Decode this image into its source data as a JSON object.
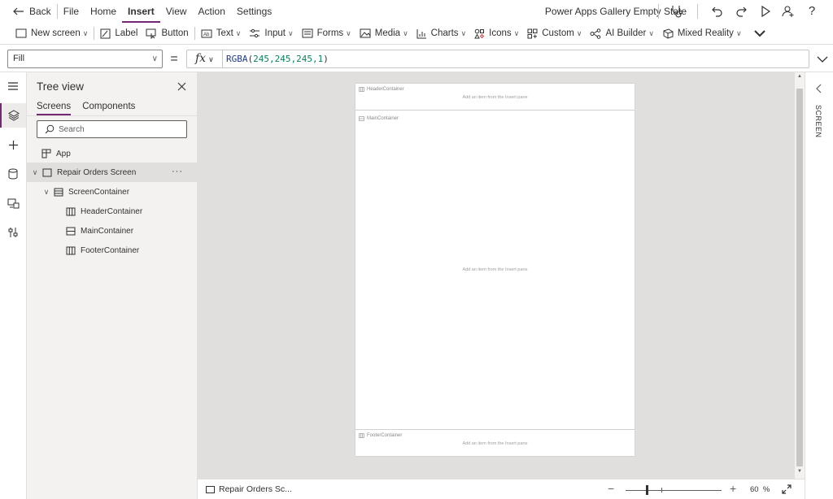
{
  "menu": {
    "back_label": "Back",
    "items": [
      "File",
      "Home",
      "Insert",
      "View",
      "Action",
      "Settings"
    ],
    "active": "Insert"
  },
  "app_title": "Power Apps Gallery Empty State",
  "ribbon": {
    "new_screen": "New screen",
    "label": "Label",
    "button": "Button",
    "text": "Text",
    "input": "Input",
    "forms": "Forms",
    "media": "Media",
    "charts": "Charts",
    "icons": "Icons",
    "custom": "Custom",
    "ai_builder": "AI Builder",
    "mixed_reality": "Mixed Reality"
  },
  "formula_bar": {
    "property": "Fill",
    "equals": "=",
    "fx": "fx",
    "formula_fn": "RGBA",
    "formula_args": "245,245,245,1"
  },
  "tree_view": {
    "title": "Tree view",
    "tabs": [
      "Screens",
      "Components"
    ],
    "active_tab": "Screens",
    "search_placeholder": "Search",
    "nodes": {
      "app": "App",
      "screen": "Repair Orders Screen",
      "screen_more": "···",
      "screen_container": "ScreenContainer",
      "header_container": "HeaderContainer",
      "main_container": "MainContainer",
      "footer_container": "FooterContainer"
    }
  },
  "canvas": {
    "header_label": "HeaderContainer",
    "main_label": "MainContainer",
    "footer_label": "FooterContainer",
    "empty_hint": "Add an item from the Insert pane"
  },
  "right_panel": {
    "label": "SCREEN"
  },
  "status_bar": {
    "screen_name": "Repair Orders Sc...",
    "zoom_value": "60",
    "zoom_unit": "%",
    "zoom_level": 60
  },
  "colors": {
    "accent": "#742774",
    "canvas_bg": "#e1dfdd",
    "panel_bg": "#f3f2f1"
  }
}
